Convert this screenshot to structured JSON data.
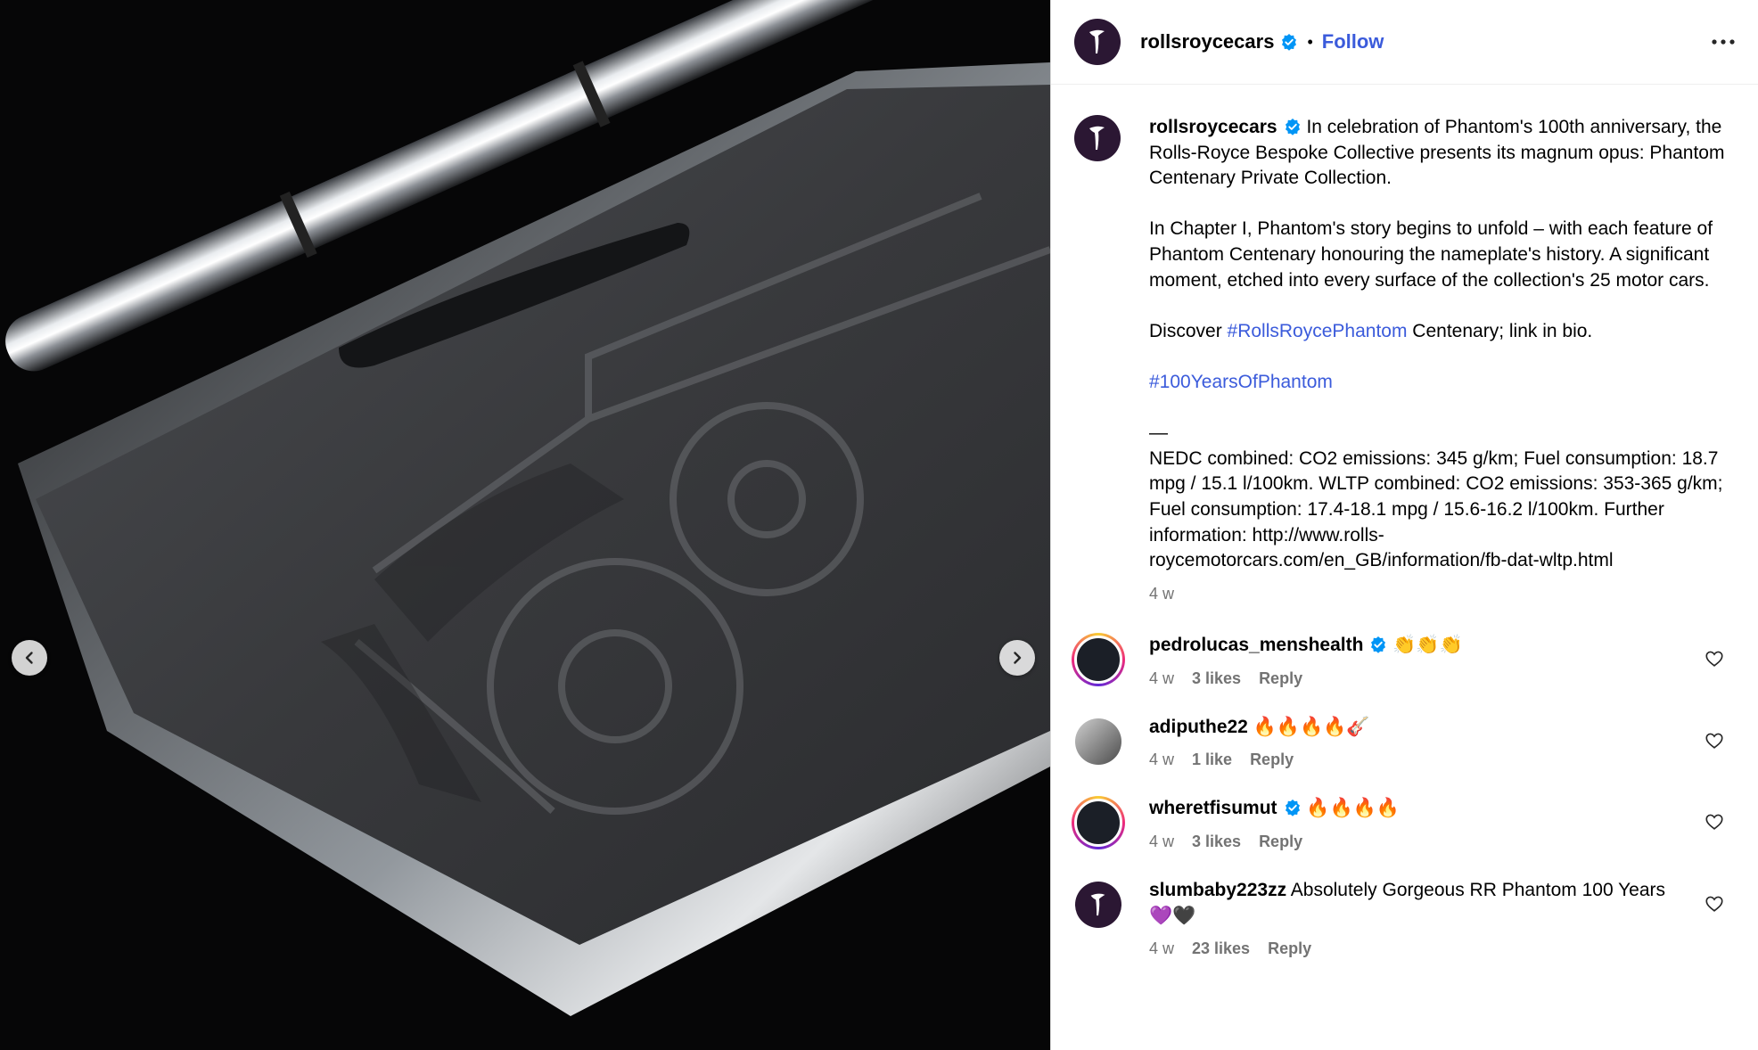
{
  "post": {
    "author": "rollsroycecars",
    "follow_label": "Follow",
    "separator": "•",
    "caption_lines": [
      "In celebration of Phantom's 100th anniversary, the Rolls-Royce Bespoke Collective presents its magnum opus: Phantom Centenary Private Collection.",
      "In Chapter I, Phantom's story begins to unfold – with each feature of Phantom Centenary honouring the nameplate's history. A significant moment, etched into every surface of the collection's 25 motor cars."
    ],
    "discover_prefix": "Discover ",
    "discover_hashtag": "#RollsRoycePhantom",
    "discover_suffix": " Centenary; link in bio.",
    "hashtag_line": "#100YearsOfPhantom",
    "dash": "—",
    "disclaimer": "NEDC combined: CO2 emissions: 345 g/km; Fuel consumption: 18.7 mpg / 15.1 l/100km. WLTP combined: CO2 emissions: 353-365 g/km; Fuel consumption: 17.4-18.1 mpg / 15.6-16.2 l/100km. Further information: http://www.rolls-roycemotorcars.com/en_GB/information/fb-dat-wltp.html",
    "time": "4 w"
  },
  "comments": [
    {
      "user": "pedrolucas_menshealth",
      "verified": true,
      "text": "👏👏👏",
      "time": "4 w",
      "likes": "3 likes",
      "reply": "Reply"
    },
    {
      "user": "adiputhe22",
      "verified": false,
      "text": "🔥🔥🔥🔥🎸",
      "time": "4 w",
      "likes": "1 like",
      "reply": "Reply"
    },
    {
      "user": "wheretfisumut",
      "verified": true,
      "text": "🔥🔥🔥🔥",
      "time": "4 w",
      "likes": "3 likes",
      "reply": "Reply"
    },
    {
      "user": "slumbaby223zz",
      "verified": false,
      "text": "Absolutely Gorgeous RR Phantom 100 Years💜🖤",
      "time": "4 w",
      "likes": "23 likes",
      "reply": "Reply"
    }
  ],
  "icons": {
    "verified": "verified-badge-icon",
    "more": "more-options-icon",
    "heart": "heart-icon",
    "prev": "chevron-left-icon",
    "next": "chevron-right-icon",
    "avatar": "spirit-of-ecstasy-logo"
  },
  "colors": {
    "link": "#3b5bdb",
    "verified": "#0095f6",
    "brand_avatar": "#2b1733",
    "meta": "#737373"
  }
}
